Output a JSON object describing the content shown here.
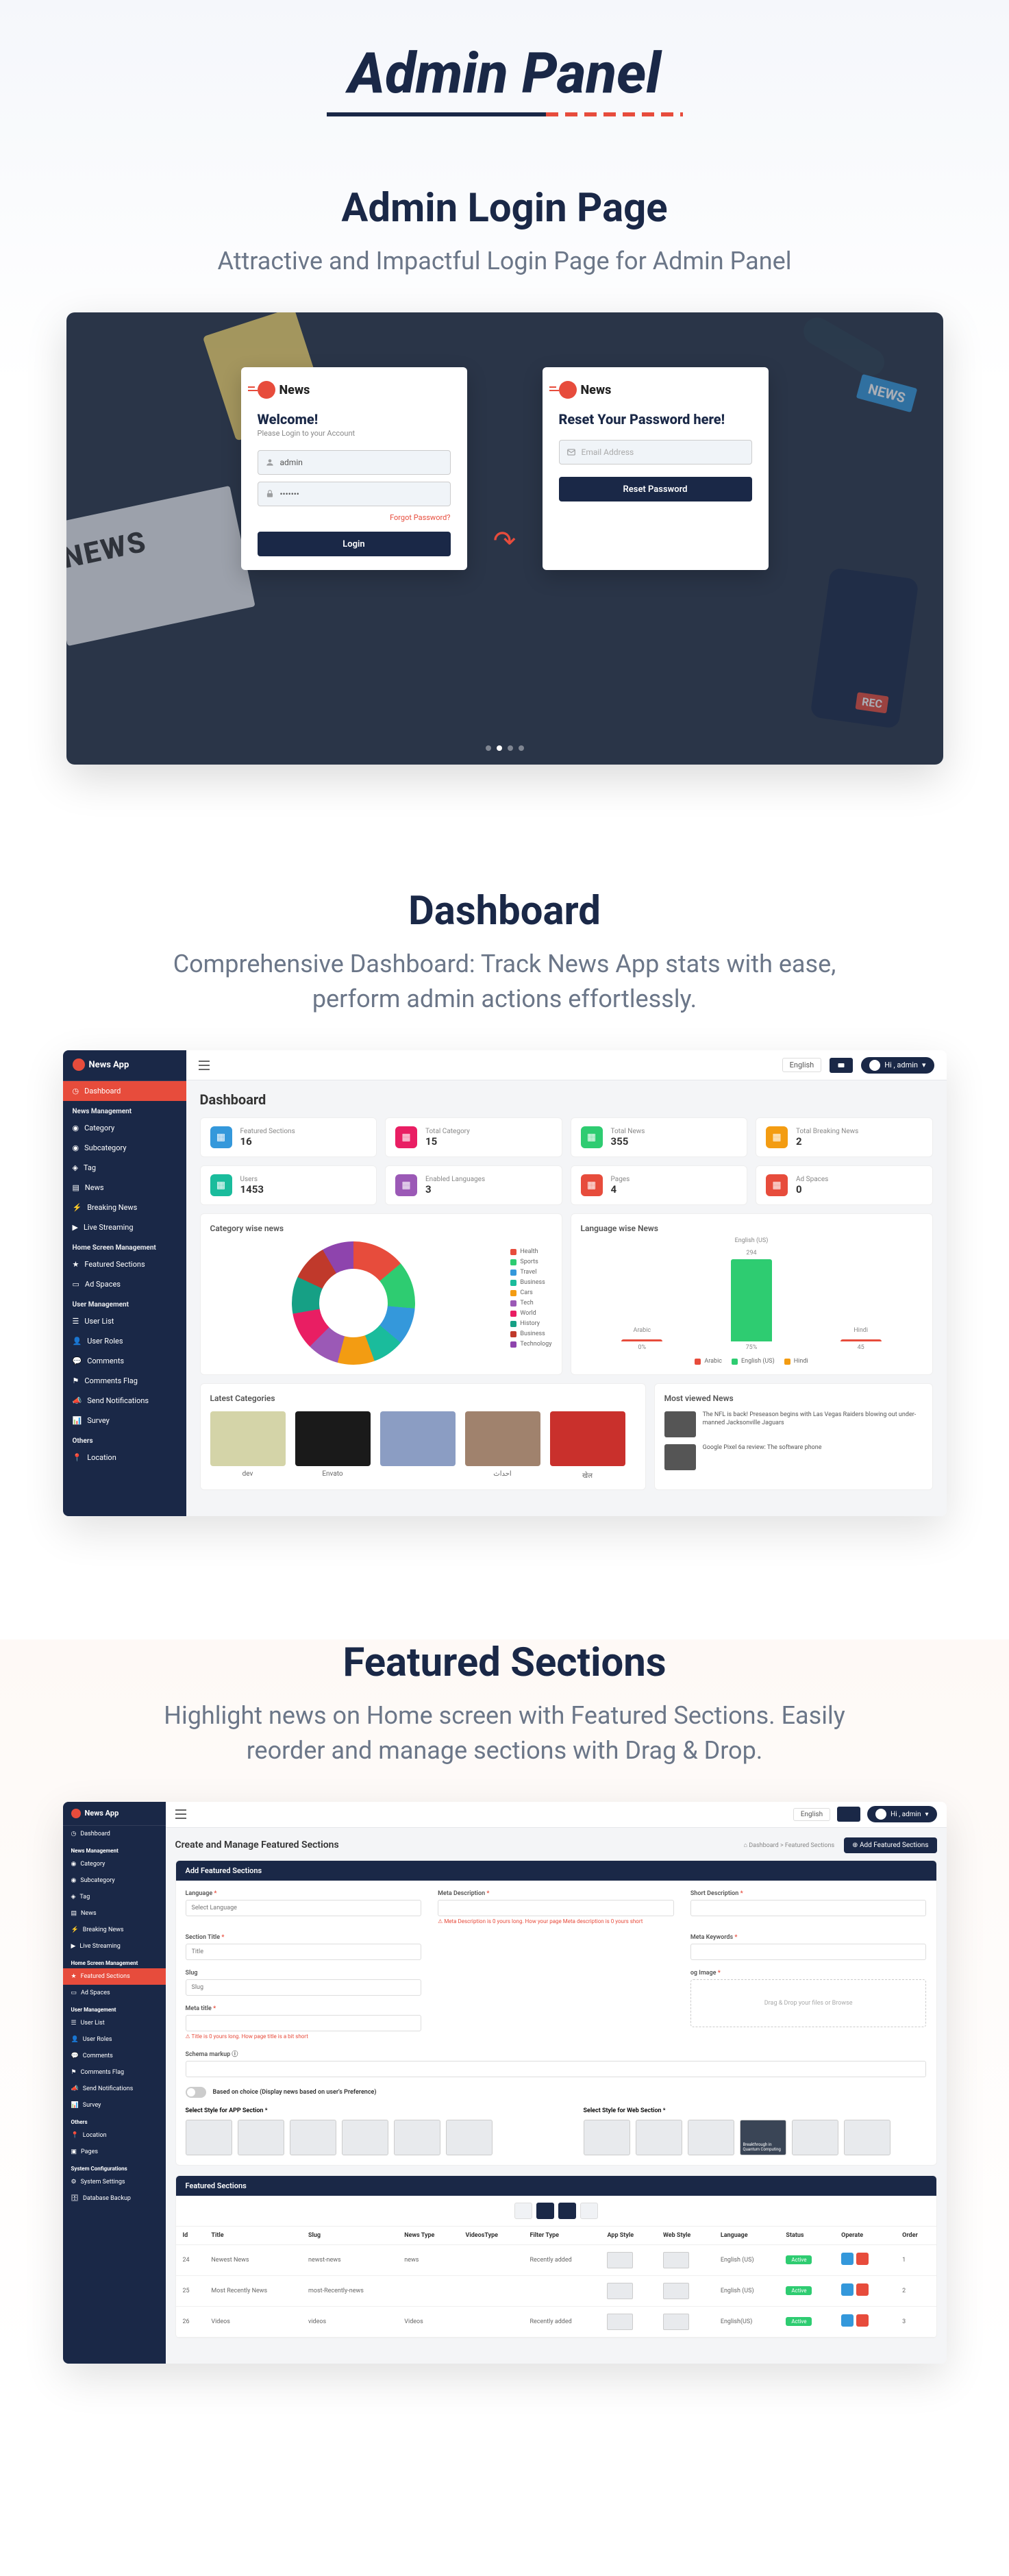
{
  "main_title": "Admin Panel",
  "sections": {
    "login": {
      "title": "Admin Login Page",
      "subtitle": "Attractive and Impactful Login Page for Admin Panel",
      "news_label": "NEWS",
      "mic_label": "NEWS",
      "logo_text": "News",
      "panel1": {
        "title": "Welcome!",
        "subtitle": "Please Login to your Account",
        "username": "admin",
        "password": "•••••••",
        "forgot": "Forgot Password?",
        "button": "Login"
      },
      "panel2": {
        "title": "Reset Your Password here!",
        "placeholder": "Email Address",
        "button": "Reset Password"
      }
    },
    "dashboard": {
      "title": "Dashboard",
      "subtitle": "Comprehensive Dashboard: Track News App stats with ease, perform admin actions effortlessly.",
      "logo_text": "News App",
      "header": {
        "lang": "English",
        "user": "Hi , admin"
      },
      "page_title": "Dashboard",
      "sidebar": {
        "dashboard": "Dashboard",
        "g1": "News Management",
        "category": "Category",
        "subcategory": "Subcategory",
        "tag": "Tag",
        "news": "News",
        "breaking": "Breaking News",
        "live": "Live Streaming",
        "g2": "Home Screen Management",
        "featured": "Featured Sections",
        "adspaces": "Ad Spaces",
        "g3": "User Management",
        "userlist": "User List",
        "userroles": "User Roles",
        "comments": "Comments",
        "commentsflag": "Comments Flag",
        "sendnotif": "Send Notifications",
        "survey": "Survey",
        "g4": "Others",
        "location": "Location"
      },
      "stats": [
        {
          "label": "Featured Sections",
          "value": "16",
          "color": "#3498db"
        },
        {
          "label": "Total Category",
          "value": "15",
          "color": "#e91e63"
        },
        {
          "label": "Total News",
          "value": "355",
          "color": "#2ecc71"
        },
        {
          "label": "Total Breaking News",
          "value": "2",
          "color": "#f39c12"
        },
        {
          "label": "Users",
          "value": "1453",
          "color": "#1abc9c"
        },
        {
          "label": "Enabled Languages",
          "value": "3",
          "color": "#9b59b6"
        },
        {
          "label": "Pages",
          "value": "4",
          "color": "#e74c3c"
        },
        {
          "label": "Ad Spaces",
          "value": "0",
          "color": "#e74c3c"
        }
      ],
      "chart1": {
        "title": "Category wise news",
        "legend": [
          "Health",
          "Sports",
          "Travel",
          "Business",
          "Cars",
          "Tech",
          "World",
          "History",
          "Business",
          "Technology"
        ]
      },
      "chart2": {
        "title": "Language wise News",
        "labels": {
          "a": "Arabic",
          "b": "English (US)",
          "c": "Hindi"
        },
        "legend": [
          "Arabic",
          "English (US)",
          "Hindi"
        ]
      },
      "latest_title": "Latest Categories",
      "cats": [
        {
          "name": "dev"
        },
        {
          "name": "Envato"
        },
        {
          "name": ""
        },
        {
          "name": "احداث"
        },
        {
          "name": "खेल"
        }
      ],
      "most_viewed_title": "Most viewed News",
      "mv": [
        {
          "text": "The NFL is back! Preseason begins with Las Vegas Raiders blowing out under-manned Jacksonville Jaguars"
        },
        {
          "text": "Google Pixel 6a review: The software phone"
        }
      ]
    },
    "featured": {
      "title": "Featured Sections",
      "subtitle": "Highlight news on Home screen with Featured Sections. Easily reorder and manage sections with Drag & Drop.",
      "logo_text": "News App",
      "header": {
        "lang": "English",
        "user": "Hi , admin"
      },
      "page_title": "Create and Manage Featured Sections",
      "crumb_dash": "Dashboard",
      "crumb_fs": "Featured Sections",
      "btn_add": "Add Featured Sections",
      "sidebar": {
        "dashboard": "Dashboard",
        "g1": "News Management",
        "category": "Category",
        "subcategory": "Subcategory",
        "tag": "Tag",
        "news": "News",
        "breaking": "Breaking News",
        "live": "Live Streaming",
        "g2": "Home Screen Management",
        "featured": "Featured Sections",
        "adspaces": "Ad Spaces",
        "g3": "User Management",
        "userlist": "User List",
        "userroles": "User Roles",
        "comments": "Comments",
        "commentsflag": "Comments Flag",
        "sendnotif": "Send Notifications",
        "survey": "Survey",
        "g4": "Others",
        "location": "Location",
        "pages": "Pages",
        "g5": "System Configurations",
        "syssettings": "System Settings",
        "dbbackup": "Database Backup"
      },
      "form": {
        "head": "Add Featured Sections",
        "language": "Language",
        "language_ph": "Select Language",
        "section_title": "Section Title",
        "section_title_ph": "Title",
        "slug": "Slug",
        "slug_ph": "Slug",
        "meta_desc": "Meta Description",
        "meta_desc_note": "Meta Description is 0 yours long. How your page Meta description is 0 yours short",
        "short_desc": "Short Description",
        "meta_keyword": "Meta Keywords",
        "meta_title": "Meta title",
        "meta_title_note": "Title is 0 yours long. How page title is a bit short",
        "og_image": "og Image",
        "dropzone": "Drag & Drop your files or Browse",
        "schema": "Schema markup",
        "toggle_label": "Based on choice (Display news based on user's Preference)",
        "style_app": "Select Style for APP Section",
        "style_web": "Select Style for Web Section",
        "thumb_caption": "Breakthrough in Quantum Computing"
      },
      "table": {
        "head": "Featured Sections",
        "cols": [
          "Id",
          "Title",
          "Slug",
          "News Type",
          "VideosType",
          "Filter Type",
          "App Style",
          "Web Style",
          "Language",
          "Status",
          "Operate",
          "Order"
        ],
        "rows": [
          {
            "id": "24",
            "title": "Newest News",
            "slug": "newst-news",
            "newstype": "news",
            "videostype": "",
            "filter": "Recently added",
            "lang": "English (US)",
            "status": "Active",
            "order": "1"
          },
          {
            "id": "25",
            "title": "Most Recently News",
            "slug": "most-Recently-news",
            "newstype": "",
            "videostype": "",
            "filter": "",
            "lang": "English (US)",
            "status": "Active",
            "order": "2"
          },
          {
            "id": "26",
            "title": "Videos",
            "slug": "videos",
            "newstype": "Videos",
            "videostype": "",
            "filter": "Recently added",
            "lang": "English(US)",
            "status": "Active",
            "order": "3"
          }
        ]
      }
    }
  },
  "chart_data": [
    {
      "type": "pie",
      "title": "Category wise news",
      "categories": [
        "Health",
        "Sports",
        "Travel",
        "Business",
        "Cars",
        "Tech",
        "World",
        "History",
        "Business",
        "Technology"
      ],
      "values": [
        14,
        12,
        10,
        9,
        10,
        8,
        10,
        11,
        9,
        7
      ]
    },
    {
      "type": "bar",
      "title": "Language wise News",
      "categories": [
        "Arabic",
        "English (US)",
        "Hindi"
      ],
      "values": [
        0,
        294,
        45
      ],
      "ylim": [
        0,
        300
      ]
    }
  ]
}
